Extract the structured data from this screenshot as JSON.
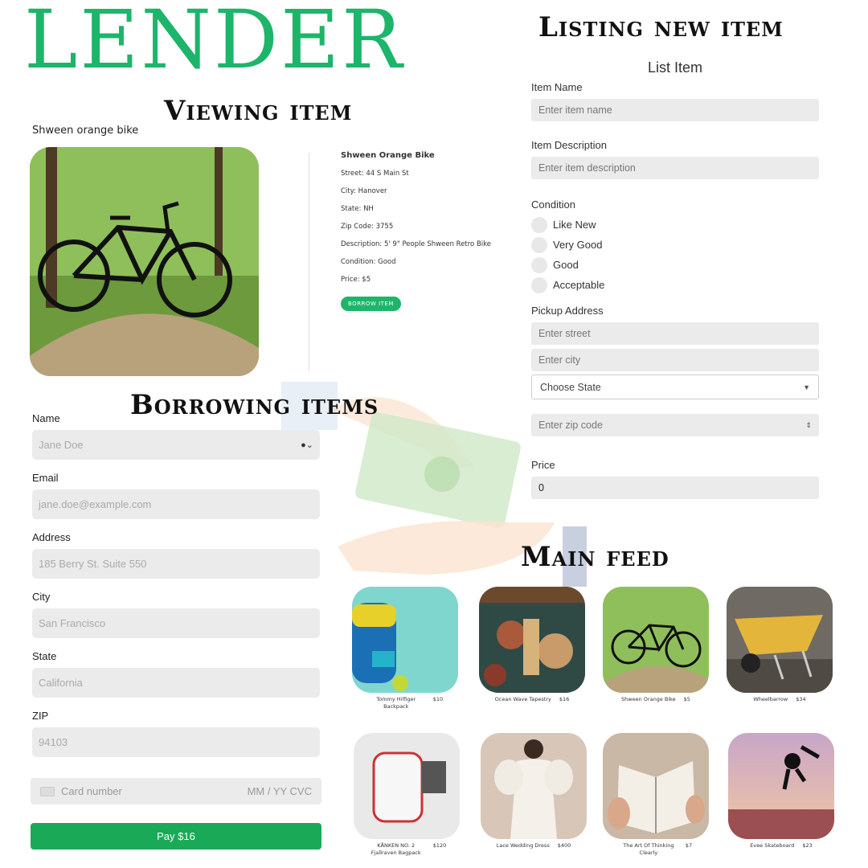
{
  "brand": "LENDER",
  "titles": {
    "viewing": "Viewing item",
    "listing": "Listing new item",
    "borrowing": "Borrowing items",
    "feed": "Main feed"
  },
  "view_item": {
    "caption": "Shween orange bike",
    "title": "Shween Orange Bike",
    "street": "Street: 44 S Main St",
    "city": "City: Hanover",
    "state": "State: NH",
    "zip": "Zip Code: 3755",
    "description": "Description: 5' 9\" People Shween Retro Bike",
    "condition": "Condition: Good",
    "price": "Price: $5",
    "borrow_button": "BORROW ITEM"
  },
  "list_form": {
    "heading": "List Item",
    "name_label": "Item Name",
    "name_placeholder": "Enter item name",
    "desc_label": "Item Description",
    "desc_placeholder": "Enter item description",
    "condition_label": "Condition",
    "conditions": [
      "Like New",
      "Very Good",
      "Good",
      "Acceptable"
    ],
    "address_label": "Pickup Address",
    "street_placeholder": "Enter street",
    "city_placeholder": "Enter city",
    "state_select": "Choose State",
    "zip_placeholder": "Enter zip code",
    "price_label": "Price",
    "price_value": "0"
  },
  "borrow_form": {
    "name_label": "Name",
    "name_placeholder": "Jane Doe",
    "email_label": "Email",
    "email_placeholder": "jane.doe@example.com",
    "address_label": "Address",
    "address_placeholder": "185 Berry St. Suite 550",
    "city_label": "City",
    "city_placeholder": "San Francisco",
    "state_label": "State",
    "state_placeholder": "California",
    "zip_label": "ZIP",
    "zip_placeholder": "94103",
    "card_placeholder": "Card number",
    "card_right": "MM / YY  CVC",
    "pay_button": "Pay $16"
  },
  "feed": [
    {
      "name": "Tommy Hilfiger Backpack",
      "price": "$10"
    },
    {
      "name": "Ocean Wave Tapestry",
      "price": "$16"
    },
    {
      "name": "Shween Orange Bike",
      "price": "$5"
    },
    {
      "name": "Wheelbarrow",
      "price": "$34"
    },
    {
      "name": "KÅNKEN NO. 2 Fjallraven Bagpack",
      "price": "$120"
    },
    {
      "name": "Lace Wedding Dress",
      "price": "$400"
    },
    {
      "name": "The Art Of Thinking Clearly",
      "price": "$7"
    },
    {
      "name": "Evee Skateboard",
      "price": "$23"
    }
  ],
  "colors": {
    "brand_green": "#1db56a",
    "pay_green": "#1aaa57",
    "field_gray": "#ebebeb"
  }
}
